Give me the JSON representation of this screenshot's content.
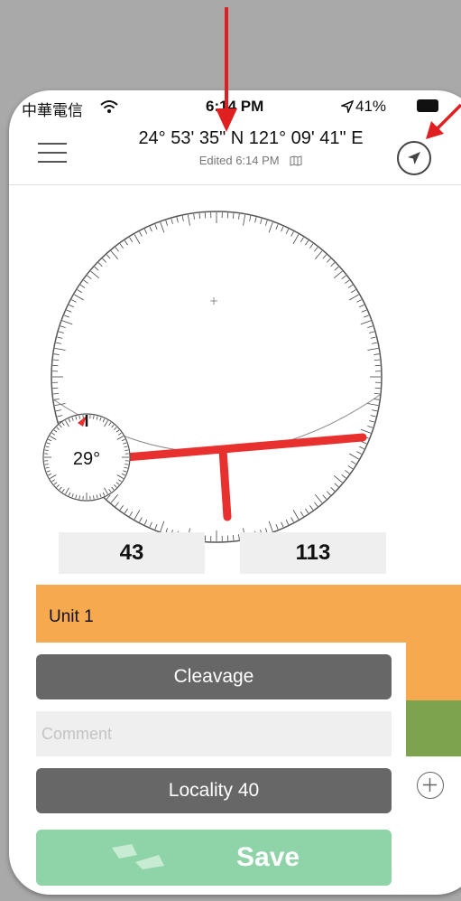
{
  "status_bar": {
    "carrier": "中華電信",
    "time": "6:14 PM",
    "battery": "41%",
    "wifi_icon": "wifi-icon",
    "location_icon": "location-arrow-icon"
  },
  "header": {
    "menu_icon": "hamburger-menu-icon",
    "coordinates": "24° 53' 35\" N  121° 09' 41\" E",
    "edited": "Edited 6:14 PM",
    "map_icon": "map-icon",
    "locate_icon": "navigation-arrow-icon"
  },
  "compass": {
    "dip_label": "29°",
    "strike_color": "#e8302e"
  },
  "readouts": {
    "left": "43",
    "right": "113"
  },
  "form": {
    "unit_label": "Unit 1",
    "feature_button": "Cleavage",
    "comment_placeholder": "Comment",
    "locality_button": "Locality 40",
    "add_icon": "plus-circle-icon",
    "save_label": "Save",
    "save_icon": "save-icon"
  },
  "colors": {
    "unit_orange": "#f6a94f",
    "unit_green": "#7ea34e",
    "save_green": "#8fd3a8",
    "annotation_red": "#e02020"
  }
}
